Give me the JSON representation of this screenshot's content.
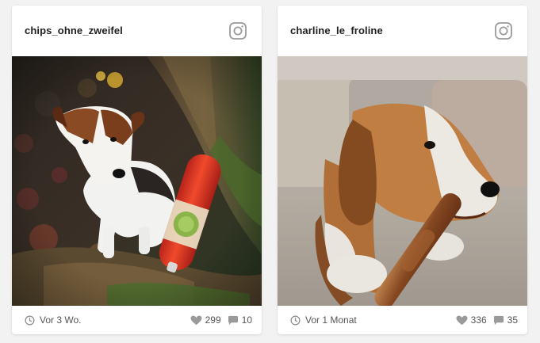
{
  "posts": [
    {
      "username": "chips_ohne_zweifel",
      "network_icon": "instagram-icon",
      "image_alt": "Jack Russell terrier sitting on a mossy tree root next to a red sausage-shaped treat roll",
      "time": "Vor 3 Wo.",
      "likes": "299",
      "comments": "10"
    },
    {
      "username": "charline_le_froline",
      "network_icon": "instagram-icon",
      "image_alt": "Beagle lying on a sofa chewing a dried chew stick",
      "time": "Vor 1 Monat",
      "likes": "336",
      "comments": "35"
    }
  ],
  "colors": {
    "background": "#f2f2f2",
    "card": "#ffffff",
    "username": "#1f1f1f",
    "meta_text": "#555555",
    "icon_gray": "#9a9a9a"
  }
}
